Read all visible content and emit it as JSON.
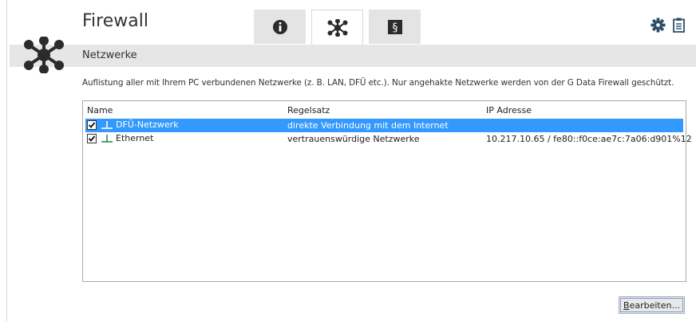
{
  "app": {
    "title": "Firewall"
  },
  "tabs": [
    {
      "icon": "info-icon",
      "active": false
    },
    {
      "icon": "network-icon",
      "active": true
    },
    {
      "icon": "paragraph-icon",
      "label": "§",
      "active": false
    }
  ],
  "top_icons": [
    "gear-icon",
    "clipboard-icon"
  ],
  "section": {
    "title": "Netzwerke"
  },
  "description": "Auflistung aller mit Ihrem PC verbundenen Netzwerke (z. B. LAN, DFÜ etc.). Nur angehakte Netzwerke werden von der G Data Firewall geschützt.",
  "table": {
    "headers": {
      "name": "Name",
      "rule": "Regelsatz",
      "ip": "IP Adresse"
    },
    "rows": [
      {
        "checked": true,
        "selected": true,
        "name": "DFÜ-Netzwerk",
        "rule": "direkte Verbindung mit dem Internet",
        "ip": ""
      },
      {
        "checked": true,
        "selected": false,
        "name": "Ethernet",
        "rule": "vertrauenswürdige Netzwerke",
        "ip": "10.217.10.65 / fe80::f0ce:ae7c:7a06:d901%12"
      }
    ]
  },
  "buttons": {
    "edit_prefix": "B",
    "edit_rest": "earbeiten..."
  },
  "colors": {
    "selection": "#3399ff",
    "band": "#e6e6e6",
    "tab_inactive": "#e4e4e4",
    "icon": "#2d4d6a"
  }
}
